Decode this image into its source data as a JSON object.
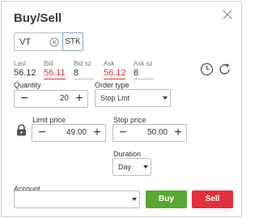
{
  "dialog": {
    "title": "Buy/Sell"
  },
  "symbol": {
    "value": "VT",
    "sec_type": "STK"
  },
  "quote": {
    "last_label": "Last",
    "last_value": "56.12",
    "bid_label": "Bid",
    "bid_value": "56.11",
    "bid_size_label": "Bid sz",
    "bid_size_value": "8",
    "ask_label": "Ask",
    "ask_value": "56.12",
    "ask_size_label": "Ask sz",
    "ask_size_value": "8"
  },
  "quantity": {
    "label": "Quantity",
    "value": "20"
  },
  "order_type": {
    "label": "Order type",
    "selected": "Stop Lmt"
  },
  "limit_price": {
    "label": "Limit price",
    "value": "49.00"
  },
  "stop_price": {
    "label": "Stop price",
    "value": "50.00"
  },
  "duration": {
    "label": "Duration",
    "selected": "Day"
  },
  "account": {
    "label": "Account",
    "selected": ""
  },
  "actions": {
    "buy_label": "Buy",
    "sell_label": "Sell"
  },
  "colors": {
    "buy": "#58a832",
    "sell": "#e0313d",
    "bid_ask_highlight": "#d9363e"
  },
  "icons": {
    "close": "close-icon",
    "clear_symbol": "clear-circle-icon",
    "history": "clock-icon",
    "refresh": "refresh-icon",
    "lock": "lock-icon"
  }
}
